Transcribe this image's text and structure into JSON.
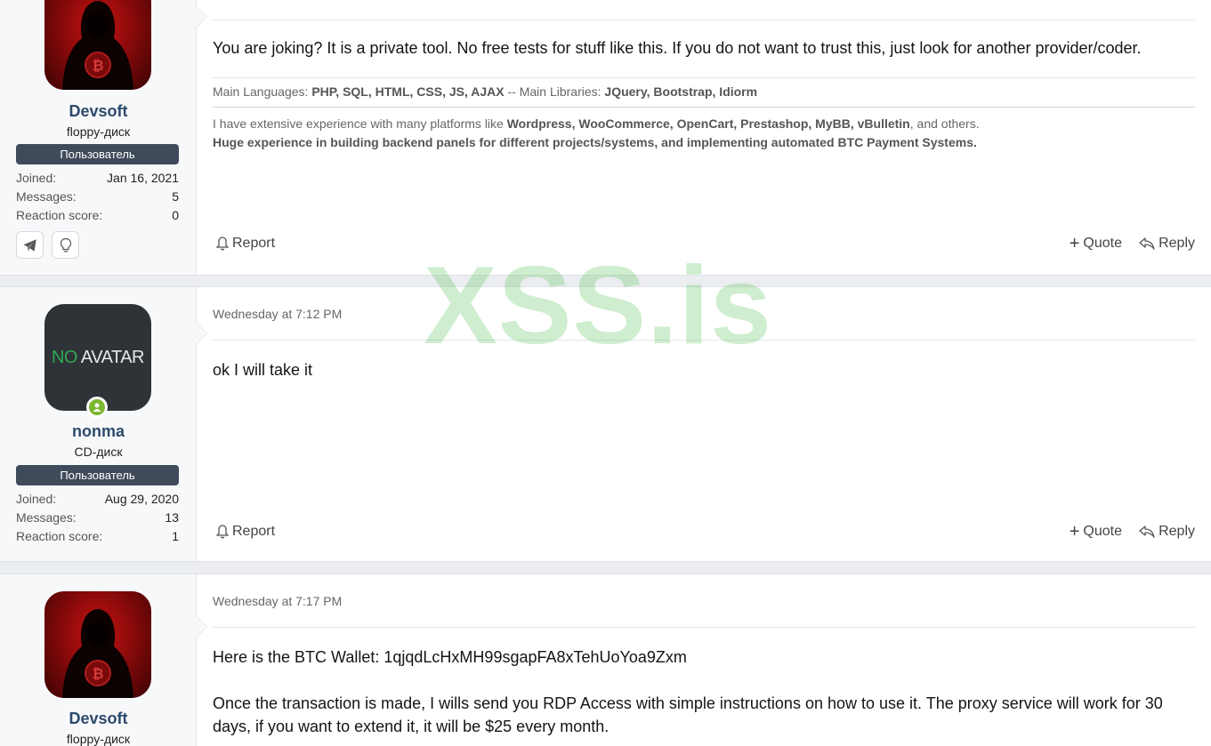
{
  "posts": [
    {
      "user": {
        "name": "Devsoft",
        "title": "floppy-диск",
        "banner": "Пользователь",
        "avatar": "hacker-btc-avatar",
        "stats": [
          {
            "label": "Joined:",
            "value": "Jan 16, 2021"
          },
          {
            "label": "Messages:",
            "value": "5"
          },
          {
            "label": "Reaction score:",
            "value": "0"
          }
        ],
        "contacts": [
          "telegram-icon",
          "lightbulb-icon"
        ]
      },
      "body": "You are joking? It is a private tool. No free tests for stuff like this. If you do not want to trust this, just look for another provider/coder.",
      "signature": {
        "lang_label": "Main Languages:",
        "languages": "PHP, SQL, HTML, CSS, JS, AJAX",
        "sep": "--",
        "lib_label": "Main Libraries:",
        "libraries": "JQuery, Bootstrap, Idiorm",
        "line1_pre": "I have extensive experience with many platforms like",
        "platforms": "Wordpress, WooCommerce, OpenCart, Prestashop, MyBB, vBulletin",
        "line1_post": ", and others.",
        "line2": "Huge experience in building backend panels for different projects/systems, and implementing automated BTC Payment Systems."
      },
      "actions": {
        "report": "Report",
        "quote": "Quote",
        "reply": "Reply"
      }
    },
    {
      "user": {
        "name": "nonma",
        "title": "CD-диск",
        "banner": "Пользователь",
        "avatar_text_no": "NO",
        "avatar_text_rest": " AVATAR",
        "stats": [
          {
            "label": "Joined:",
            "value": "Aug 29, 2020"
          },
          {
            "label": "Messages:",
            "value": "13"
          },
          {
            "label": "Reaction score:",
            "value": "1"
          }
        ]
      },
      "date": "Wednesday at 7:12 PM",
      "body": "ok I will take it",
      "actions": {
        "report": "Report",
        "quote": "Quote",
        "reply": "Reply"
      }
    },
    {
      "user": {
        "name": "Devsoft",
        "title": "floppy-диск",
        "avatar": "hacker-btc-avatar"
      },
      "date": "Wednesday at 7:17 PM",
      "body1": "Here is the BTC Wallet: 1qjqdLcHxMH99sgapFA8xTehUoYoa9Zxm",
      "body2": "Once the transaction is made, I wills send you RDP Access with simple instructions on how to use it. The proxy service will work for 30 days, if you want to extend it, it will be $25 every month."
    }
  ],
  "watermark": "XSS.is"
}
